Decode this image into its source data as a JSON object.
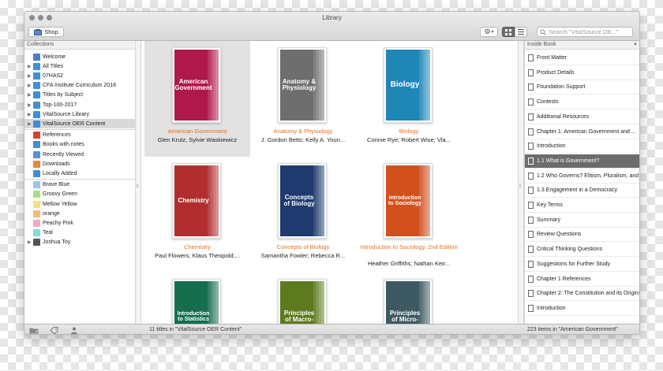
{
  "window": {
    "title": "Library"
  },
  "toolbar": {
    "shop_label": "Shop",
    "gear_caret": "▾",
    "search_placeholder": "Search \"VitalSource OE...\""
  },
  "left_panel": {
    "header": "Collections",
    "items": [
      {
        "label": "Welcome",
        "icon_color": "#4a7bd0",
        "disclosure": ""
      },
      {
        "label": "All Titles",
        "icon_color": "#3d8fd6",
        "disclosure": "▶"
      },
      {
        "label": "07HAS2",
        "icon_color": "#3d8fd6",
        "disclosure": "▶"
      },
      {
        "label": "CFA Institute Curriculum 2018",
        "icon_color": "#3d8fd6",
        "disclosure": "▶"
      },
      {
        "label": "Titles by Subject",
        "icon_color": "#3d8fd6",
        "disclosure": "▶"
      },
      {
        "label": "Top-100-2017",
        "icon_color": "#3d8fd6",
        "disclosure": "▶"
      },
      {
        "label": "VitalSource Library",
        "icon_color": "#3d8fd6",
        "disclosure": "▶"
      },
      {
        "label": "VitalSource OER Content",
        "icon_color": "#3d8fd6",
        "disclosure": "▶"
      },
      {
        "label": "References",
        "icon_color": "#d9432b",
        "disclosure": ""
      },
      {
        "label": "Books with notes",
        "icon_color": "#3d8fd6",
        "disclosure": ""
      },
      {
        "label": "Recently Viewed",
        "icon_color": "#5a8fd0",
        "disclosure": ""
      },
      {
        "label": "Downloads",
        "icon_color": "#e6893a",
        "disclosure": ""
      },
      {
        "label": "Locally Added",
        "icon_color": "#3d8fd6",
        "disclosure": ""
      },
      {
        "label": "Brave Blue",
        "icon_color": "#9fc2ef",
        "disclosure": ""
      },
      {
        "label": "Groovy Green",
        "icon_color": "#a9dc8c",
        "disclosure": ""
      },
      {
        "label": "Mellow Yellow",
        "icon_color": "#f2e27a",
        "disclosure": ""
      },
      {
        "label": "orange",
        "icon_color": "#f5bd70",
        "disclosure": ""
      },
      {
        "label": "Peachy Pink",
        "icon_color": "#f3aac4",
        "disclosure": ""
      },
      {
        "label": "Teal",
        "icon_color": "#86d9d8",
        "disclosure": ""
      },
      {
        "label": "Joshua Toy",
        "icon_color": "#555555",
        "disclosure": "▶"
      }
    ]
  },
  "books": [
    {
      "cover_text": "American Government",
      "cover_color": "#b0184b",
      "title": "American Government",
      "authors": "Glen Krutz, Sylvie Waskiewicz"
    },
    {
      "cover_text": "Anatomy & Physiology",
      "cover_color": "#6e6e6e",
      "title": "Anatomy & Physiology",
      "authors": "J. Gordon Betts; Kelly A. Youn..."
    },
    {
      "cover_text": "Biology",
      "cover_color": "#1f86b8",
      "title": "Biology",
      "authors": "Connie Rye; Robert Wise; Vla..."
    },
    {
      "cover_text": "Chemistry",
      "cover_color": "#b12e2e",
      "title": "Chemistry",
      "authors": "Paul Flowers; Klaus Theopold;..."
    },
    {
      "cover_text": "Concepts of Biology",
      "cover_color": "#1e3a6e",
      "title": "Concepts of Biology",
      "authors": "Samantha Fowler; Rebecca R..."
    },
    {
      "cover_text": "Introduction to Sociology",
      "cover_color": "#d2501e",
      "title": "Introduction to Sociology, 2nd Edition",
      "authors": "Heather Griffiths; Nathan Keir..."
    },
    {
      "cover_text": "Introduction to Statistics",
      "cover_color": "#166e4e",
      "title": "",
      "authors": ""
    },
    {
      "cover_text": "Principles of Macro-",
      "cover_color": "#5d7a1e",
      "title": "",
      "authors": ""
    },
    {
      "cover_text": "Principles of Micro-",
      "cover_color": "#3d5a62",
      "title": "",
      "authors": ""
    }
  ],
  "right_panel": {
    "header": "Inside Book",
    "items": [
      "Front Matter",
      "Product Details",
      "Foundation Support",
      "Contests",
      "Additional Resources",
      "Chapter 1: American Government and ...",
      "Introduction",
      "1.1 What is Government?",
      "1.2 Who Governs? Elitism, Pluralism, and ...",
      "1.3 Engagement in a Democracy",
      "Key Terms",
      "Summary",
      "Review Questions",
      "Critical Thinking Questions",
      "Suggestions for Further Study",
      "Chapter 1 References",
      "Chapter 2: The Constitution and its Origins",
      "Introduction"
    ],
    "selected_index": 7
  },
  "status": {
    "center_text": "11 titles in \"VitalSource OER Content\"",
    "right_text": "223 items in \"American Government\""
  }
}
